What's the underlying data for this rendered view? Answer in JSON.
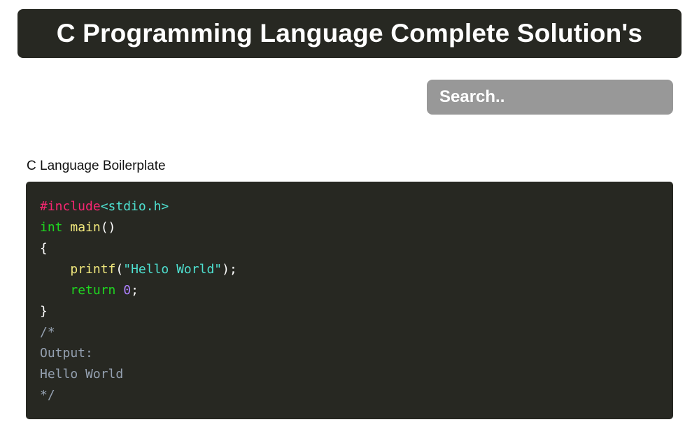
{
  "header": {
    "title": "C Programming Language Complete Solution's"
  },
  "search": {
    "placeholder": "Search.."
  },
  "section": {
    "title": "C Language Boilerplate"
  },
  "code": {
    "lines": [
      [
        {
          "t": "#include",
          "c": "pre"
        },
        {
          "t": "<stdio.h>",
          "c": "hdr"
        }
      ],
      [
        {
          "t": "int",
          "c": "kw"
        },
        {
          "t": " ",
          "c": "punc"
        },
        {
          "t": "main",
          "c": "fn"
        },
        {
          "t": "()",
          "c": "punc"
        }
      ],
      [
        {
          "t": "{",
          "c": "punc"
        }
      ],
      [
        {
          "t": "    ",
          "c": "punc"
        },
        {
          "t": "printf",
          "c": "fn"
        },
        {
          "t": "(",
          "c": "punc"
        },
        {
          "t": "\"Hello World\"",
          "c": "str"
        },
        {
          "t": ");",
          "c": "punc"
        }
      ],
      [
        {
          "t": "    ",
          "c": "punc"
        },
        {
          "t": "return",
          "c": "kw"
        },
        {
          "t": " ",
          "c": "punc"
        },
        {
          "t": "0",
          "c": "num"
        },
        {
          "t": ";",
          "c": "punc"
        }
      ],
      [
        {
          "t": "}",
          "c": "punc"
        }
      ],
      [
        {
          "t": "/*",
          "c": "cmt"
        }
      ],
      [
        {
          "t": "Output:",
          "c": "cmt"
        }
      ],
      [
        {
          "t": "Hello World",
          "c": "cmt"
        }
      ],
      [
        {
          "t": "*/",
          "c": "cmt"
        }
      ]
    ]
  },
  "colors": {
    "header_bg": "#272822",
    "search_bg": "#989898",
    "code_bg": "#272822"
  }
}
